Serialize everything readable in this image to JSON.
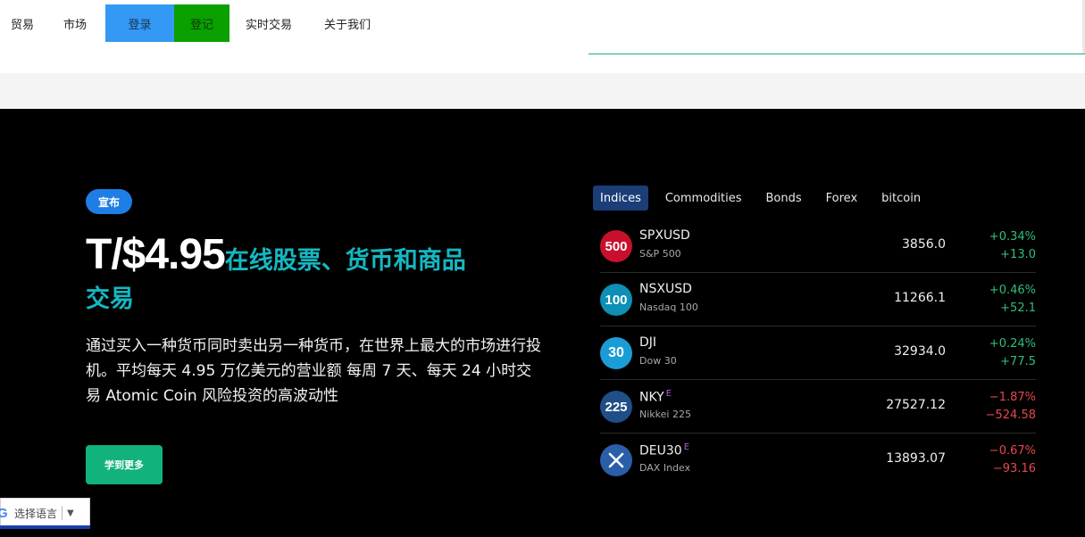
{
  "nav": {
    "trade": "贸易",
    "market": "市场",
    "login": "登录",
    "register": "登记",
    "live_trading": "实时交易",
    "about": "关于我们"
  },
  "hero": {
    "badge": "宣布",
    "headline_price": "T/$4.95",
    "headline_tail": "在线股票、货币和商品",
    "headline_line2": "交易",
    "description": "通过买入一种货币同时卖出另一种货币，在世界上最大的市场进行投机。平均每天 4.95 万亿美元的营业额 每周 7 天、每天 24 小时交易 Atomic Coin 风险投资的高波动性",
    "cta": "学到更多"
  },
  "market": {
    "tabs": [
      "Indices",
      "Commodities",
      "Bonds",
      "Forex",
      "bitcoin"
    ],
    "active_tab": "Indices",
    "rows": [
      {
        "badge": "500",
        "badge_color": "#c8102e",
        "symbol": "SPXUSD",
        "flag": "",
        "name": "S&P 500",
        "price": "3856.0",
        "pct": "+0.34%",
        "change": "+13.0",
        "trend": "up"
      },
      {
        "badge": "100",
        "badge_color": "#0e8fb5",
        "symbol": "NSXUSD",
        "flag": "",
        "name": "Nasdaq 100",
        "price": "11266.1",
        "pct": "+0.46%",
        "change": "+52.1",
        "trend": "up"
      },
      {
        "badge": "30",
        "badge_color": "#1a9dd6",
        "symbol": "DJI",
        "flag": "",
        "name": "Dow 30",
        "price": "32934.0",
        "pct": "+0.24%",
        "change": "+77.5",
        "trend": "up"
      },
      {
        "badge": "225",
        "badge_color": "#1f4f86",
        "symbol": "NKY",
        "flag": "E",
        "name": "Nikkei 225",
        "price": "27527.12",
        "pct": "−1.87%",
        "change": "−524.58",
        "trend": "down"
      },
      {
        "badge": "",
        "badge_color": "#2a5ea8",
        "symbol": "DEU30",
        "flag": "E",
        "name": "DAX Index",
        "price": "13893.07",
        "pct": "−0.67%",
        "change": "−93.16",
        "trend": "down"
      }
    ]
  },
  "translate": {
    "logo": "G",
    "label": "选择语言",
    "arrow": "▼"
  }
}
